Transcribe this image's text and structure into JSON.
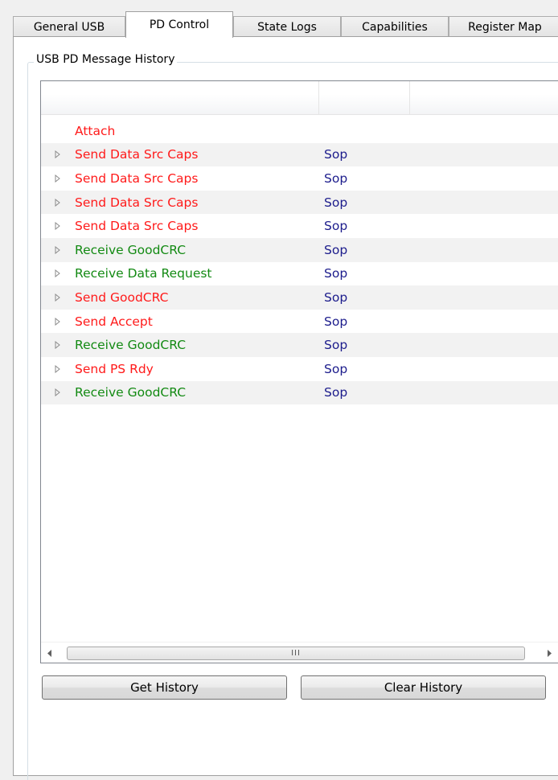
{
  "tabs": [
    {
      "label": "General USB"
    },
    {
      "label": "PD Control",
      "active": true
    },
    {
      "label": "State Logs"
    },
    {
      "label": "Capabilities"
    },
    {
      "label": "Register Map"
    }
  ],
  "group": {
    "title": "USB PD Message History"
  },
  "messages": [
    {
      "text": "Attach",
      "sop": "",
      "kind": "send",
      "expandable": false
    },
    {
      "text": "Send Data Src Caps",
      "sop": "Sop",
      "kind": "send",
      "expandable": true
    },
    {
      "text": "Send Data Src Caps",
      "sop": "Sop",
      "kind": "send",
      "expandable": true
    },
    {
      "text": "Send Data Src Caps",
      "sop": "Sop",
      "kind": "send",
      "expandable": true
    },
    {
      "text": "Send Data Src Caps",
      "sop": "Sop",
      "kind": "send",
      "expandable": true
    },
    {
      "text": "Receive GoodCRC",
      "sop": "Sop",
      "kind": "recv",
      "expandable": true
    },
    {
      "text": "Receive Data Request",
      "sop": "Sop",
      "kind": "recv",
      "expandable": true
    },
    {
      "text": "Send GoodCRC",
      "sop": "Sop",
      "kind": "send",
      "expandable": true
    },
    {
      "text": "Send Accept",
      "sop": "Sop",
      "kind": "send",
      "expandable": true
    },
    {
      "text": "Receive GoodCRC",
      "sop": "Sop",
      "kind": "recv",
      "expandable": true
    },
    {
      "text": "Send PS Rdy",
      "sop": "Sop",
      "kind": "send",
      "expandable": true
    },
    {
      "text": "Receive GoodCRC",
      "sop": "Sop",
      "kind": "recv",
      "expandable": true
    }
  ],
  "scrollbar": {
    "grip": "III",
    "left_icon": "scroll-left-arrow-icon",
    "right_icon": "scroll-right-arrow-icon"
  },
  "buttons": {
    "get_history": "Get History",
    "clear_history": "Clear History"
  },
  "colors": {
    "send": "#ff1a1a",
    "receive": "#138a13",
    "sop": "#1c1c8c"
  }
}
